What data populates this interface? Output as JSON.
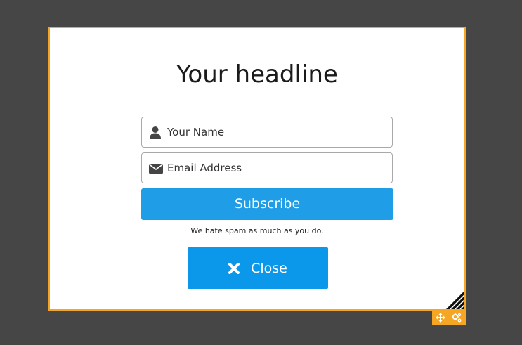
{
  "popup": {
    "headline": "Your headline",
    "name_field": {
      "placeholder": "Your Name",
      "value": "",
      "icon": "user-icon"
    },
    "email_field": {
      "placeholder": "Email Address",
      "value": "",
      "icon": "envelope-icon"
    },
    "subscribe_label": "Subscribe",
    "spam_note": "We hate spam as much as you do.",
    "close_label": "Close",
    "close_icon": "close-icon"
  },
  "editor_tools": {
    "move_icon": "move-icon",
    "settings_icon": "gears-icon",
    "resize_icon": "resize-handle-icon"
  },
  "colors": {
    "background": "#464646",
    "popup_border": "#f5a623",
    "subscribe_button": "#1f9de6",
    "close_button": "#0b97ea"
  }
}
